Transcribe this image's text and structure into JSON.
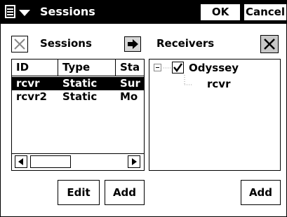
{
  "titlebar": {
    "title": "Sessions",
    "ok_label": "OK",
    "cancel_label": "Cancel",
    "menu_icon": "start-menu-icon"
  },
  "sessions_panel": {
    "label": "Sessions",
    "columns": [
      "ID",
      "Type",
      "Sta"
    ],
    "rows": [
      {
        "id": "rcvr",
        "type": "Static",
        "status": "Sur",
        "selected": true
      },
      {
        "id": "rcvr2",
        "type": "Static",
        "status": "Mo",
        "selected": false
      }
    ],
    "edit_label": "Edit",
    "add_label": "Add"
  },
  "receivers_panel": {
    "label": "Receivers",
    "tree": {
      "root": {
        "label": "Odyssey",
        "checked": true,
        "expanded": true
      },
      "children": [
        {
          "label": "rcvr"
        }
      ]
    },
    "add_label": "Add"
  }
}
